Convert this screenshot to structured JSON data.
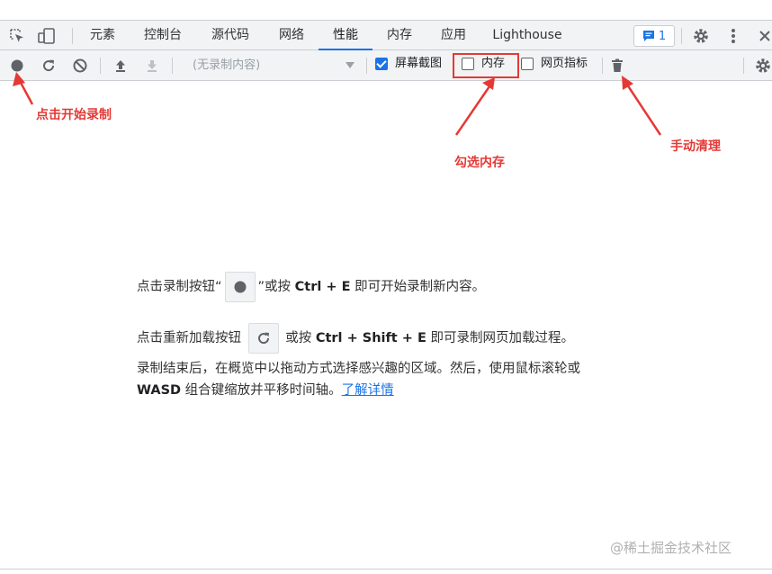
{
  "tabs": [
    {
      "label": "元素"
    },
    {
      "label": "控制台"
    },
    {
      "label": "源代码"
    },
    {
      "label": "网络"
    },
    {
      "label": "性能",
      "active": true
    },
    {
      "label": "内存"
    },
    {
      "label": "应用"
    },
    {
      "label": "Lighthouse"
    }
  ],
  "header": {
    "message_count": "1",
    "icons": [
      "inspect-icon",
      "device-toggle-icon",
      "message-icon",
      "gear-icon",
      "more-vert-icon",
      "close-icon"
    ]
  },
  "toolbar": {
    "profile_placeholder": "(无录制内容)",
    "screenshots_label": "屏幕截图",
    "screenshots_checked": true,
    "memory_label": "内存",
    "memory_checked": false,
    "webvitals_label": "网页指标",
    "webvitals_checked": false,
    "icons": [
      "record-icon",
      "reload-icon",
      "clear-icon",
      "upload-icon",
      "download-icon",
      "trash-icon",
      "gear-icon"
    ]
  },
  "annotations": {
    "record": "点击开始录制",
    "memory": "勾选内存",
    "gc": "手动清理"
  },
  "landing": {
    "line1_pre": "点击录制按钮“",
    "line1_post": "”或按",
    "line1_key": "Ctrl + E",
    "line1_end": "即可开始录制新内容。",
    "line2_pre": "点击重新加载按钮",
    "line2_post": "或按",
    "line2_key": "Ctrl + Shift + E",
    "line2_end": "即可录制网页加载过程。",
    "line3": "录制结束后，在概览中以拖动方式选择感兴趣的区域。然后，使用鼠标滚轮或",
    "line4_key": "WASD",
    "line4_text": "组合键缩放并平移时间轴。",
    "learn_more": "了解详情"
  },
  "watermark": "@稀土掘金技术社区",
  "colors": {
    "accent": "#1a73e8",
    "annotation_red": "#e53935",
    "toolbar_bg": "#f1f3f4"
  }
}
